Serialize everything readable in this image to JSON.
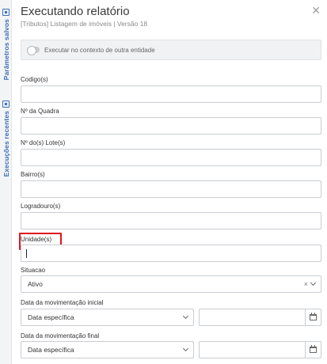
{
  "rail": {
    "tab1": "Parâmetros salvos",
    "tab2": "Execuções recentes"
  },
  "header": {
    "title": "Executando relatório",
    "subtitle": "[Tributos] Listagem de imóveis | Versão 18",
    "close_glyph": "✕"
  },
  "context": {
    "toggle_label": "Executar no contexto de outra entidade",
    "toggle_on": false
  },
  "fields": {
    "codigos": {
      "label": "Codigo(s)",
      "value": ""
    },
    "quadra": {
      "label": "Nº da Quadra",
      "value": ""
    },
    "lotes": {
      "label": "Nº do(s) Lote(s)",
      "value": ""
    },
    "bairro": {
      "label": "Bairro(s)",
      "value": ""
    },
    "logradouro": {
      "label": "Logradouro(s)",
      "value": ""
    },
    "unidades": {
      "label": "Unidade(s)",
      "value": ""
    }
  },
  "situacao": {
    "label": "Situacao",
    "value": "Ativo",
    "clear_glyph": "×"
  },
  "data_inicial": {
    "label": "Data da movimentação inicial",
    "mode": "Data específica",
    "date": ""
  },
  "data_final": {
    "label": "Data da movimentação final",
    "mode": "Data específica",
    "date": ""
  },
  "colors": {
    "accent": "#3d6fb6",
    "highlight": "#e0151c",
    "border": "#c9cdd3"
  }
}
